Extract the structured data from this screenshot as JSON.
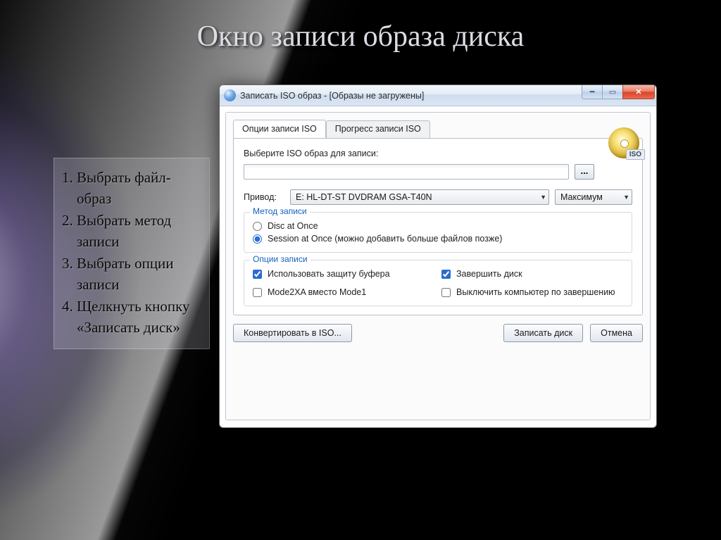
{
  "slide": {
    "title": "Окно записи образа диска",
    "steps": [
      "Выбрать файл-образ",
      "Выбрать метод записи",
      "Выбрать опции записи",
      "Щелкнуть кнопку «Записать диск»"
    ]
  },
  "window": {
    "title": "Записать ISO образ - [Образы не загружены]",
    "tabs": {
      "options": "Опции записи ISO",
      "progress": "Прогресс записи ISO"
    },
    "select_label": "Выберите ISO образ для записи:",
    "iso_path": "",
    "browse_label": "...",
    "iso_badge": "ISO",
    "drive_label": "Привод:",
    "drive_value": "E: HL-DT-ST DVDRAM GSA-T40N",
    "speed_value": "Максимум",
    "method": {
      "legend": "Метод записи",
      "dao": "Disc at Once",
      "sao": "Session at Once (можно добавить больше файлов позже)",
      "selected": "sao"
    },
    "options": {
      "legend": "Опции записи",
      "buffer": {
        "label": "Использовать защиту буфера",
        "checked": true
      },
      "finalize": {
        "label": "Завершить диск",
        "checked": true
      },
      "mode2xa": {
        "label": "Mode2XA вместо Mode1",
        "checked": false
      },
      "shutdown": {
        "label": "Выключить компьютер по завершению",
        "checked": false
      }
    },
    "buttons": {
      "convert": "Конвертировать в ISO...",
      "burn": "Записать диск",
      "cancel": "Отмена"
    }
  }
}
